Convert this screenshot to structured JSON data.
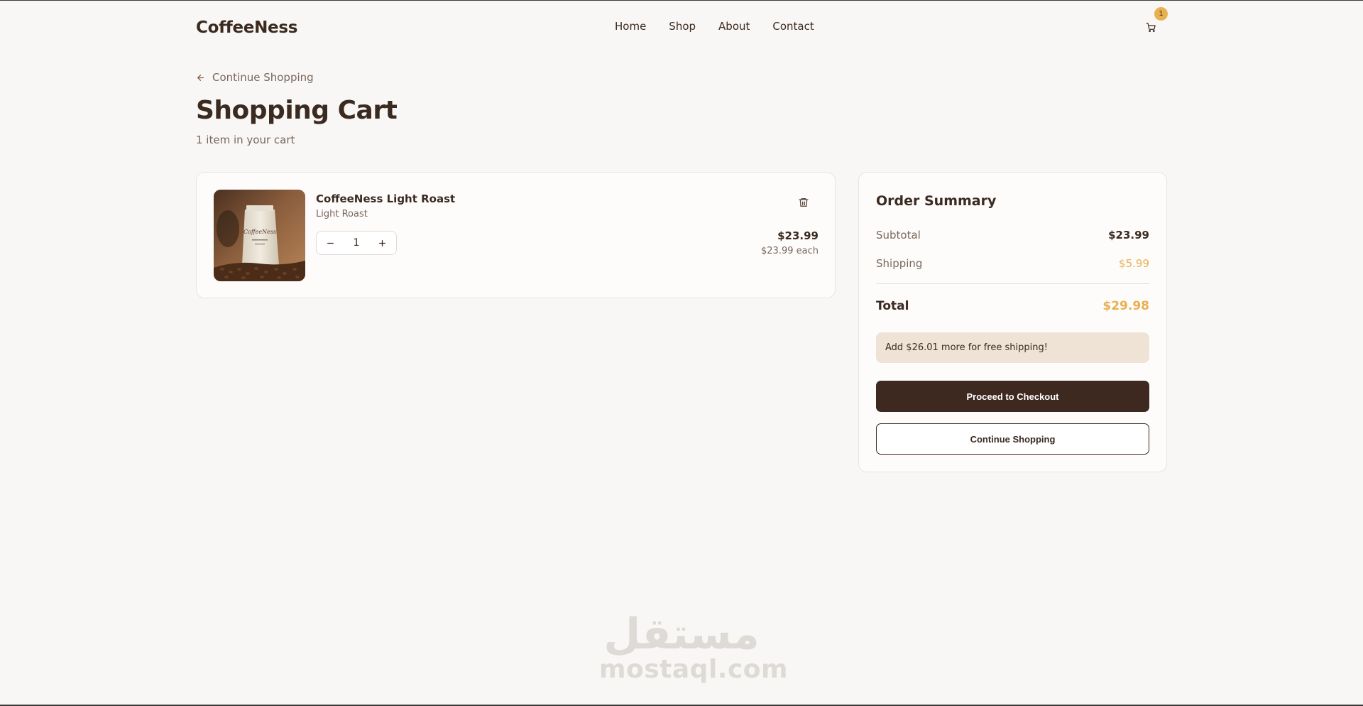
{
  "header": {
    "logo": "CoffeeNess",
    "nav": [
      "Home",
      "Shop",
      "About",
      "Contact"
    ],
    "cart_count": "1"
  },
  "back_link": "Continue Shopping",
  "page": {
    "title": "Shopping Cart",
    "subtitle": "1 item in your cart"
  },
  "item": {
    "name": "CoffeeNess Light Roast",
    "variant": "Light Roast",
    "quantity": "1",
    "price": "$23.99",
    "each": "$23.99 each",
    "image_label": "CoffeeNess"
  },
  "summary": {
    "title": "Order Summary",
    "subtotal_label": "Subtotal",
    "subtotal": "$23.99",
    "shipping_label": "Shipping",
    "shipping": "$5.99",
    "total_label": "Total",
    "total": "$29.98",
    "promo": "Add $26.01 more for free shipping!",
    "checkout_label": "Proceed to Checkout",
    "continue_label": "Continue Shopping"
  },
  "watermark": {
    "arabic": "مستقل",
    "latin": "mostaql.com"
  },
  "colors": {
    "background": "#f9f7f5",
    "brand_dark": "#3d2920",
    "accent": "#e8b04f",
    "promo_bg": "#efe3d6"
  },
  "icons": [
    "arrow-left-icon",
    "cart-icon",
    "trash-icon",
    "minus-icon",
    "plus-icon"
  ]
}
